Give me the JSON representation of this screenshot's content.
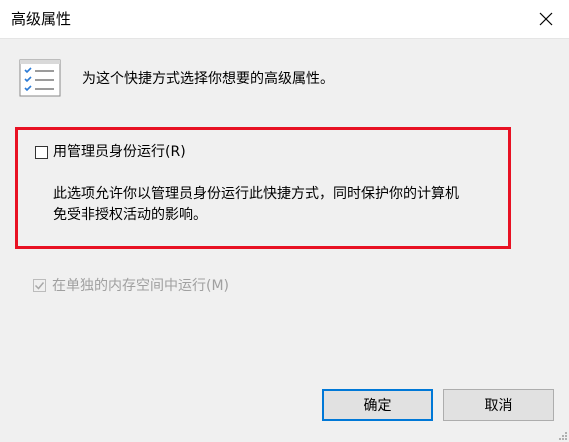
{
  "window": {
    "title": "高级属性",
    "close_icon": "close-icon"
  },
  "header": {
    "icon": "properties-list-icon",
    "text": "为这个快捷方式选择你想要的高级属性。"
  },
  "run_as_admin": {
    "label": "用管理员身份运行(R)",
    "checked": false,
    "description_line1": "此选项允许你以管理员身份运行此快捷方式，同时保护你的计算机",
    "description_line2": "免受非授权活动的影响。",
    "highlight_color": "#e81123"
  },
  "separate_memory": {
    "label": "在单独的内存空间中运行(M)",
    "checked": true,
    "disabled": true
  },
  "buttons": {
    "ok_label": "确定",
    "cancel_label": "取消"
  },
  "colors": {
    "accent": "#0078d7",
    "background": "#f0f0f0"
  }
}
